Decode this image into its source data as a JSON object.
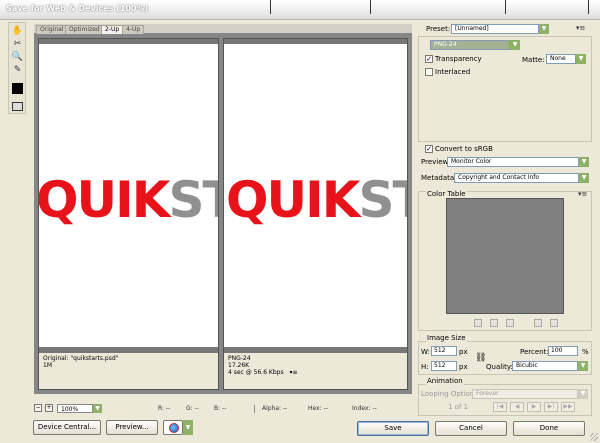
{
  "window": {
    "title": "Save for Web & Devices (100%)"
  },
  "view_tabs": [
    {
      "label": "Original"
    },
    {
      "label": "Optimized"
    },
    {
      "label": "2-Up"
    },
    {
      "label": "4-Up"
    }
  ],
  "panes": {
    "left": {
      "line1": "Original: \"quikstarts.psd\"",
      "line2": "1M"
    },
    "right": {
      "line1": "PNG-24",
      "line2": "17.26K",
      "line3": "4 sec @ 56.6 Kbps",
      "menu_glyph": "▾≡"
    }
  },
  "artwork": {
    "red_text": "QUIK",
    "grey_text": "ST"
  },
  "statusbar": {
    "minus": "−",
    "plus": "+",
    "zoom": "100%",
    "r": "R: --",
    "g": "G: --",
    "b": "B: --",
    "alpha": "Alpha: --",
    "hex": "Hex: --",
    "index": "Index: --"
  },
  "bottom_buttons": {
    "device_central": "Device Central...",
    "preview": "Preview...",
    "save": "Save",
    "cancel": "Cancel",
    "done": "Done"
  },
  "settings": {
    "preset_label": "Preset:",
    "preset_value": "[Unnamed]",
    "format_value": "PNG-24",
    "transparency_label": "Transparency",
    "transparency_checked": true,
    "matte_label": "Matte:",
    "matte_value": "None",
    "interlaced_label": "Interlaced",
    "interlaced_checked": false,
    "convert_srgb_label": "Convert to sRGB",
    "convert_srgb_checked": true,
    "preview_label": "Preview:",
    "preview_value": "Monitor Color",
    "metadata_label": "Metadata:",
    "metadata_value": "Copyright and Contact Info",
    "color_table_label": "Color Table",
    "image_size_label": "Image Size",
    "w_label": "W:",
    "w_value": "512",
    "h_label": "H:",
    "h_value": "512",
    "px": "px",
    "percent_label": "Percent:",
    "percent_value": "100",
    "percent_unit": "%",
    "quality_label": "Quality:",
    "quality_value": "Bicubic",
    "animation_label": "Animation",
    "looping_label": "Looping Options:",
    "looping_value": "Forever",
    "frame_counter": "1 of 1"
  },
  "colors": {
    "accent_green": "#8fb067",
    "logo_red": "#e8121a",
    "logo_grey": "#909090",
    "color_table_fill": "#808080"
  }
}
